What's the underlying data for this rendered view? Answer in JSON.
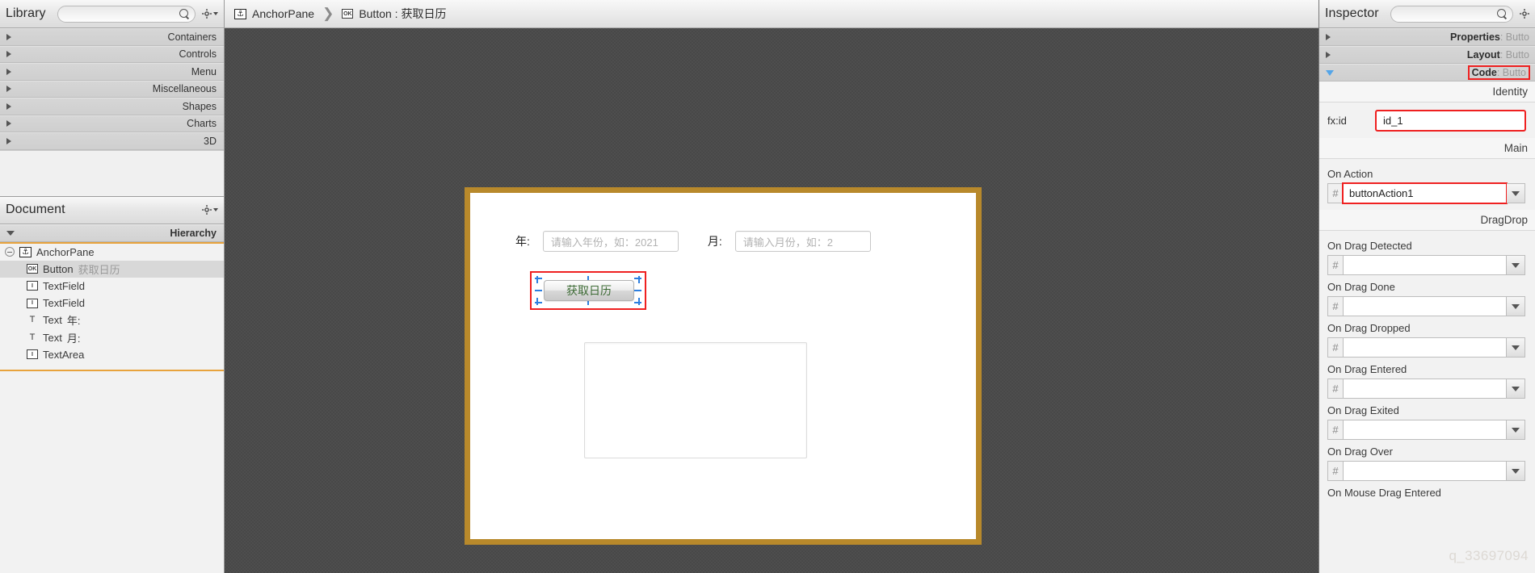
{
  "library": {
    "title": "Library",
    "search_placeholder": "",
    "search_icon": "search-icon",
    "gear_icon": "gear-icon",
    "categories": [
      {
        "label": "Containers"
      },
      {
        "label": "Controls"
      },
      {
        "label": "Menu"
      },
      {
        "label": "Miscellaneous"
      },
      {
        "label": "Shapes"
      },
      {
        "label": "Charts"
      },
      {
        "label": "3D"
      }
    ]
  },
  "document": {
    "title": "Document",
    "gear_icon": "gear-icon",
    "hierarchy_label": "Hierarchy",
    "tree": [
      {
        "icon": "anchor-pane-icon",
        "label": "AnchorPane",
        "label2": "",
        "depth": 0,
        "selected": false,
        "collapser": true
      },
      {
        "icon": "button-icon",
        "label": "Button",
        "label2": "获取日历",
        "depth": 1,
        "selected": true,
        "collapser": false
      },
      {
        "icon": "textfield-icon",
        "label": "TextField",
        "label2": "",
        "depth": 1,
        "selected": false,
        "collapser": false
      },
      {
        "icon": "textfield-icon",
        "label": "TextField",
        "label2": "",
        "depth": 1,
        "selected": false,
        "collapser": false
      },
      {
        "icon": "text-icon",
        "label": "Text",
        "label2": "年:",
        "depth": 1,
        "selected": false,
        "collapser": false
      },
      {
        "icon": "text-icon",
        "label": "Text",
        "label2": "月:",
        "depth": 1,
        "selected": false,
        "collapser": false
      },
      {
        "icon": "textarea-icon",
        "label": "TextArea",
        "label2": "",
        "depth": 1,
        "selected": false,
        "collapser": false
      }
    ]
  },
  "breadcrumb": {
    "root_icon": "anchor-pane-icon",
    "root_label": "AnchorPane",
    "separator": "❯",
    "leaf_icon": "button-icon",
    "leaf_label": "Button : 获取日历"
  },
  "canvas": {
    "border_color": "#b8892b",
    "year_label": "年:",
    "year_placeholder": "请输入年份，如：2021",
    "month_label": "月:",
    "month_placeholder": "请输入月份，如：2",
    "button_label": "获取日历",
    "button_text_color": "#3d6b35",
    "selection_color": "#ef2020",
    "handle_color": "#2d7fe0",
    "textarea_value": ""
  },
  "inspector": {
    "title": "Inspector",
    "search_icon": "search-icon",
    "gear_icon": "gear-icon",
    "accordions": [
      {
        "label": "Properties",
        "sub": ": Butto",
        "expanded": false,
        "highlighted": false
      },
      {
        "label": "Layout",
        "sub": ": Butto",
        "expanded": false,
        "highlighted": false
      },
      {
        "label": "Code",
        "sub": ": Butto",
        "expanded": true,
        "highlighted": true
      }
    ],
    "identity_section": "Identity",
    "fxid_label": "fx:id",
    "fxid_value": "id_1",
    "main_section": "Main",
    "on_action_label": "On Action",
    "on_action_value": "buttonAction1",
    "hash_symbol": "#",
    "dragdrop_section": "DragDrop",
    "drag_fields": [
      {
        "label": "On Drag Detected",
        "value": ""
      },
      {
        "label": "On Drag Done",
        "value": ""
      },
      {
        "label": "On Drag Dropped",
        "value": ""
      },
      {
        "label": "On Drag Entered",
        "value": ""
      },
      {
        "label": "On Drag Exited",
        "value": ""
      },
      {
        "label": "On Drag Over",
        "value": ""
      },
      {
        "label": "On Mouse Drag Entered",
        "value": ""
      }
    ]
  },
  "watermark": "q_33697094"
}
